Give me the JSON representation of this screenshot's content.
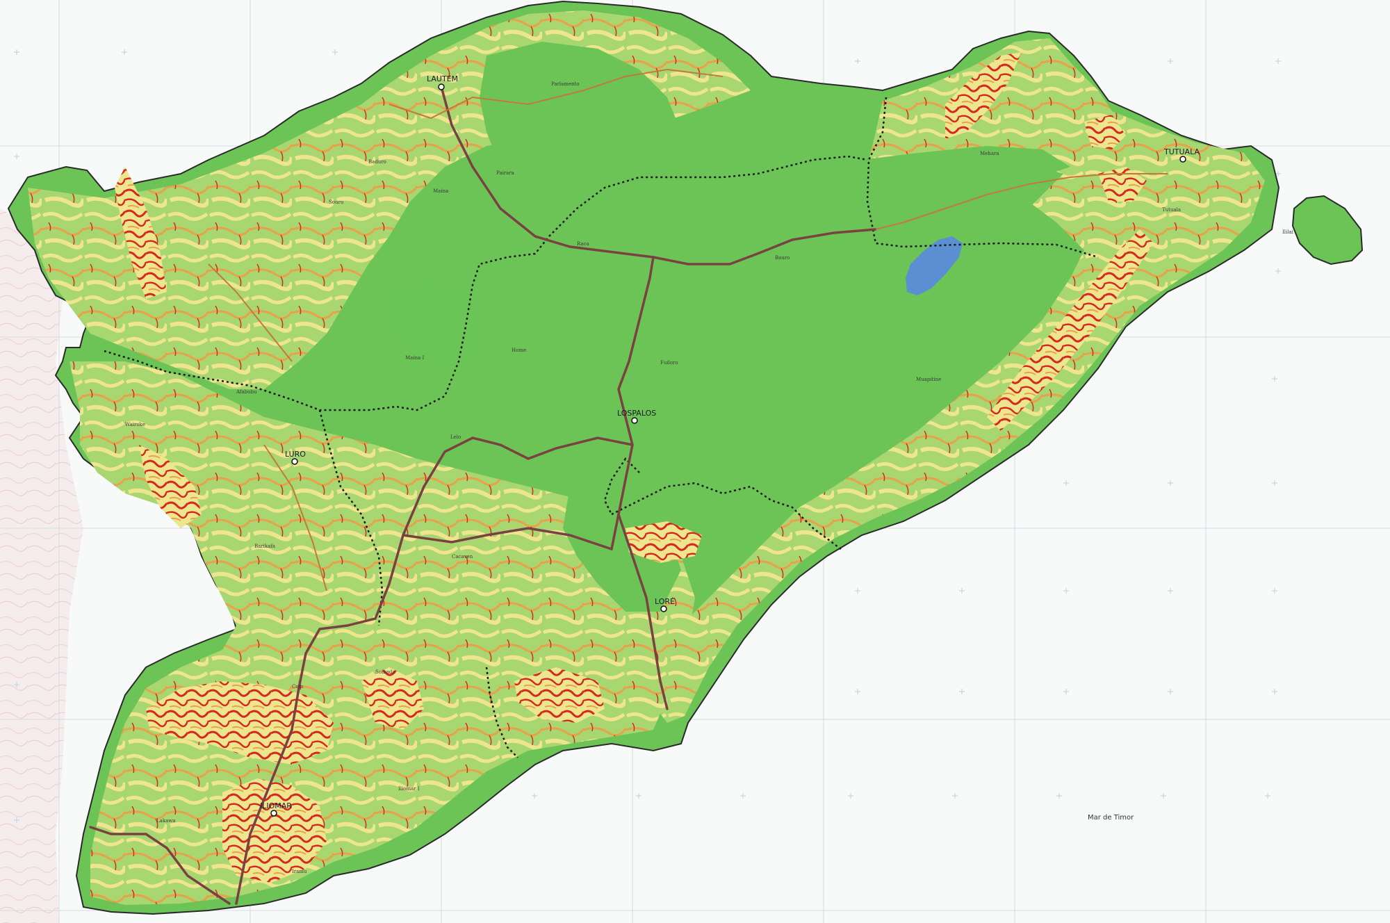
{
  "map": {
    "colors": {
      "sea": "#f8f9f9",
      "grid": "#d6d9dc",
      "flat": "#6cc457",
      "moderate": "#eee58f",
      "steep": "#d42a1e",
      "mid": "#e8a24a",
      "lake": "#5b8fd1",
      "road": "#7a4141",
      "boundary": "#1a1a1a",
      "coast": "#2a2a2a",
      "west_land": "#f2e4e4"
    },
    "towns": [
      {
        "name": "LAUTEM",
        "id": "lautem"
      },
      {
        "name": "TUTUALA",
        "id": "tutuala"
      },
      {
        "name": "LOSPALOS",
        "id": "lospalos"
      },
      {
        "name": "LURO",
        "id": "luro"
      },
      {
        "name": "LORÉ",
        "id": "lore"
      },
      {
        "name": "ILIOMAR",
        "id": "iliomar"
      }
    ],
    "sea_label": "Mar de Timor",
    "small_labels": [
      "Parlamento",
      "Pairara",
      "Baduro",
      "Maina",
      "Souru",
      "Bauro",
      "Mehara",
      "Tutuala",
      "Fuiloro",
      "Home",
      "Maina I",
      "Lelo",
      "Cacaven",
      "Muapitine",
      "Iliomar I",
      "Ililai",
      "Afabubu",
      "Wairoke",
      "Barikafa",
      "Lakawa",
      "Soibada",
      "Com",
      "Iramu",
      "Raca"
    ]
  }
}
